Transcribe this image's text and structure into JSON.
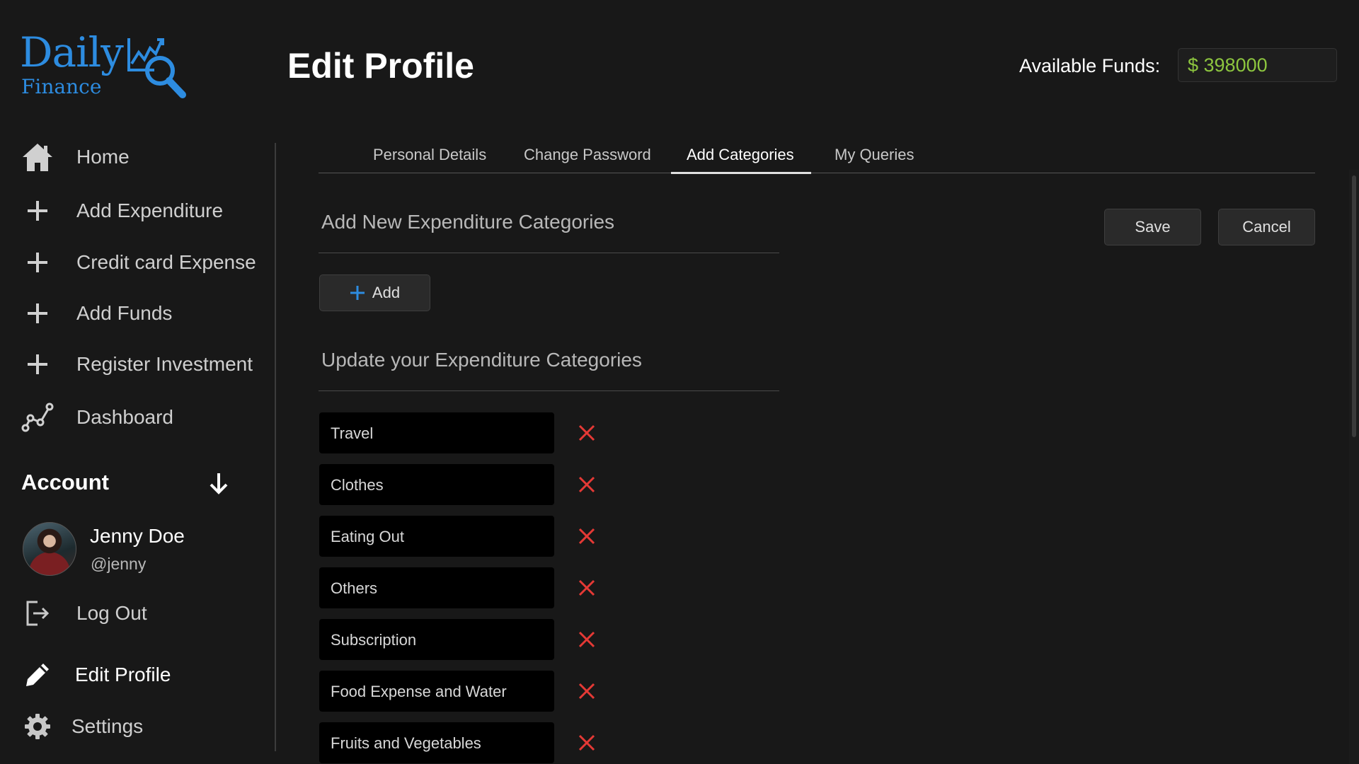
{
  "app": {
    "logo_line1": "Daily",
    "logo_line2": "Finance",
    "brand_color": "#2d8ce0"
  },
  "header": {
    "title": "Edit Profile",
    "funds_label": "Available Funds:",
    "funds_value": "$ 398000",
    "funds_color": "#8dc63f"
  },
  "sidebar": {
    "items": [
      {
        "label": "Home",
        "icon": "home-icon"
      },
      {
        "label": "Add Expenditure",
        "icon": "plus-icon"
      },
      {
        "label": "Credit card Expense",
        "icon": "plus-icon"
      },
      {
        "label": "Add Funds",
        "icon": "plus-icon"
      },
      {
        "label": "Register Investment",
        "icon": "plus-icon"
      },
      {
        "label": "Dashboard",
        "icon": "chart-line-icon"
      }
    ],
    "account_label": "Account",
    "user": {
      "name": "Jenny Doe",
      "handle": "@jenny"
    },
    "logout_label": "Log Out",
    "edit_profile_label": "Edit Profile",
    "settings_label": "Settings"
  },
  "tabs": [
    {
      "label": "Personal Details",
      "active": false
    },
    {
      "label": "Change Password",
      "active": false
    },
    {
      "label": "Add Categories",
      "active": true
    },
    {
      "label": "My Queries",
      "active": false
    }
  ],
  "content": {
    "add_heading": "Add New Expenditure Categories",
    "add_button": "Add",
    "update_heading": "Update your Expenditure Categories",
    "save_button": "Save",
    "cancel_button": "Cancel",
    "delete_color": "#e53935",
    "categories": [
      "Travel",
      "Clothes",
      "Eating Out",
      "Others",
      "Subscription",
      "Food Expense and Water",
      "Fruits and Vegetables"
    ]
  }
}
